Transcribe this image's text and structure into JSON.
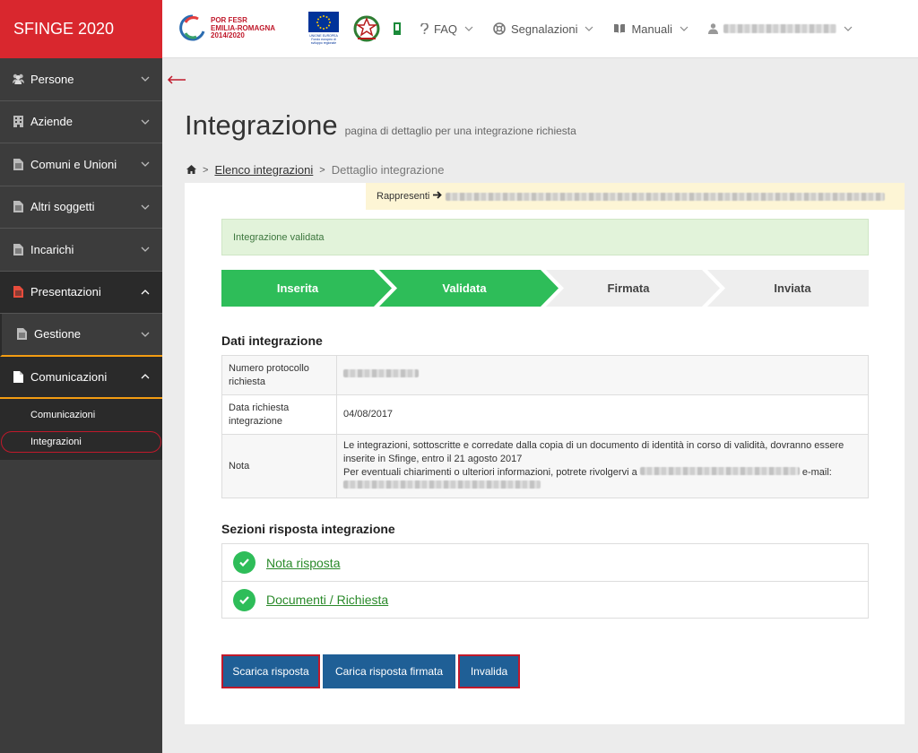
{
  "app": {
    "brand": "SFINGE 2020"
  },
  "topbar": {
    "logo_por_text": [
      "POR FESR",
      "EMILIA-ROMAGNA",
      "2014/2020"
    ],
    "logo_eu_caption": "UNIONE EUROPEA Fondo europeo di sviluppo regionale",
    "menus": [
      {
        "label": "FAQ",
        "icon": "question-icon"
      },
      {
        "label": "Segnalazioni",
        "icon": "lifebuoy-icon"
      },
      {
        "label": "Manuali",
        "icon": "book-icon"
      }
    ]
  },
  "sidebar": {
    "items": [
      {
        "label": "Persone",
        "icon": "users-icon"
      },
      {
        "label": "Aziende",
        "icon": "building-icon"
      },
      {
        "label": "Comuni e Unioni",
        "icon": "document-icon"
      },
      {
        "label": "Altri soggetti",
        "icon": "document-icon"
      },
      {
        "label": "Incarichi",
        "icon": "document-icon"
      },
      {
        "label": "Presentazioni",
        "icon": "document-icon"
      },
      {
        "label": "Gestione",
        "icon": "document-icon"
      },
      {
        "label": "Comunicazioni",
        "icon": "document-icon"
      }
    ],
    "sub_items": [
      {
        "label": "Comunicazioni"
      },
      {
        "label": "Integrazioni"
      }
    ]
  },
  "page": {
    "title": "Integrazione",
    "subtitle": "pagina di dettaglio per una integrazione richiesta",
    "breadcrumb": {
      "link": "Elenco integrazioni",
      "current": "Dettaglio integrazione"
    },
    "rappresenti_label": "Rappresenti",
    "alert": "Integrazione validata",
    "steps": [
      {
        "label": "Inserita",
        "done": true
      },
      {
        "label": "Validata",
        "done": true
      },
      {
        "label": "Firmata",
        "done": false
      },
      {
        "label": "Inviata",
        "done": false
      }
    ],
    "dati_title": "Dati integrazione",
    "dati": {
      "protocollo_label": "Numero protocollo richiesta",
      "data_label": "Data richiesta integrazione",
      "data_value": "04/08/2017",
      "nota_label": "Nota",
      "nota_line1": "Le integrazioni, sottoscritte e corredate dalla copia di un documento di identità in corso di validità, dovranno essere inserite in Sfinge, entro il 21 agosto 2017",
      "nota_line2_prefix": "Per eventuali chiarimenti o ulteriori informazioni, potrete rivolgervi a",
      "nota_email_label": "e-mail:"
    },
    "sezioni_title": "Sezioni risposta integrazione",
    "sezioni": [
      {
        "label": "Nota risposta"
      },
      {
        "label": "Documenti / Richiesta"
      }
    ],
    "buttons": {
      "scarica": "Scarica risposta",
      "carica": "Carica risposta firmata",
      "invalida": "Invalida"
    }
  },
  "colors": {
    "brand_red": "#d9272e",
    "sidebar_bg": "#3c3c3c",
    "step_done": "#2ebd59",
    "step_todo": "#eeeeee",
    "button_blue": "#1f5f96",
    "highlight_red": "#c0192b"
  }
}
